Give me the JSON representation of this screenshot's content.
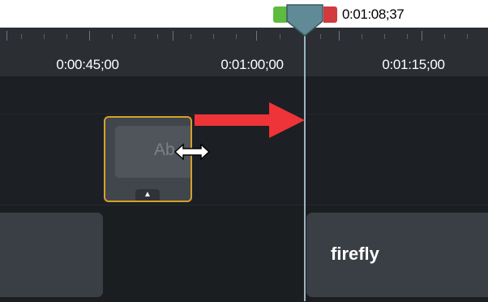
{
  "playhead": {
    "time": "0:01:08;37"
  },
  "ruler": {
    "labels": [
      "0:00:45;00",
      "0:01:00;00",
      "0:01:15;00"
    ]
  },
  "clips": {
    "annotation": {
      "label": "Ab",
      "expand_icon": "triangle-up-icon"
    },
    "firefly": {
      "label": "firefly"
    }
  },
  "overlay": {
    "arrow_icon": "red-arrow-icon",
    "cursor_icon": "horizontal-resize-cursor-icon"
  },
  "colors": {
    "background": "#1d2024",
    "ruler": "#2b2e33",
    "clip": "#3a3f45",
    "selection_border": "#d4a228",
    "playhead": "#5f8a96",
    "in_marker": "#5dbb3f",
    "out_marker": "#d23a3e",
    "arrow": "#ee3438"
  }
}
